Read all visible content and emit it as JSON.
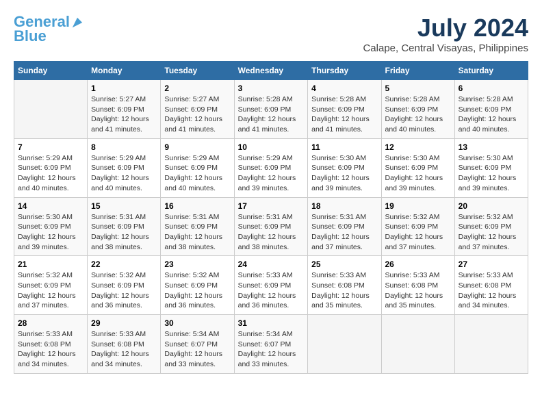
{
  "logo": {
    "line1": "General",
    "line2": "Blue"
  },
  "title": "July 2024",
  "subtitle": "Calape, Central Visayas, Philippines",
  "days_header": [
    "Sunday",
    "Monday",
    "Tuesday",
    "Wednesday",
    "Thursday",
    "Friday",
    "Saturday"
  ],
  "weeks": [
    [
      {
        "num": "",
        "info": ""
      },
      {
        "num": "1",
        "info": "Sunrise: 5:27 AM\nSunset: 6:09 PM\nDaylight: 12 hours\nand 41 minutes."
      },
      {
        "num": "2",
        "info": "Sunrise: 5:27 AM\nSunset: 6:09 PM\nDaylight: 12 hours\nand 41 minutes."
      },
      {
        "num": "3",
        "info": "Sunrise: 5:28 AM\nSunset: 6:09 PM\nDaylight: 12 hours\nand 41 minutes."
      },
      {
        "num": "4",
        "info": "Sunrise: 5:28 AM\nSunset: 6:09 PM\nDaylight: 12 hours\nand 41 minutes."
      },
      {
        "num": "5",
        "info": "Sunrise: 5:28 AM\nSunset: 6:09 PM\nDaylight: 12 hours\nand 40 minutes."
      },
      {
        "num": "6",
        "info": "Sunrise: 5:28 AM\nSunset: 6:09 PM\nDaylight: 12 hours\nand 40 minutes."
      }
    ],
    [
      {
        "num": "7",
        "info": "Sunrise: 5:29 AM\nSunset: 6:09 PM\nDaylight: 12 hours\nand 40 minutes."
      },
      {
        "num": "8",
        "info": "Sunrise: 5:29 AM\nSunset: 6:09 PM\nDaylight: 12 hours\nand 40 minutes."
      },
      {
        "num": "9",
        "info": "Sunrise: 5:29 AM\nSunset: 6:09 PM\nDaylight: 12 hours\nand 40 minutes."
      },
      {
        "num": "10",
        "info": "Sunrise: 5:29 AM\nSunset: 6:09 PM\nDaylight: 12 hours\nand 39 minutes."
      },
      {
        "num": "11",
        "info": "Sunrise: 5:30 AM\nSunset: 6:09 PM\nDaylight: 12 hours\nand 39 minutes."
      },
      {
        "num": "12",
        "info": "Sunrise: 5:30 AM\nSunset: 6:09 PM\nDaylight: 12 hours\nand 39 minutes."
      },
      {
        "num": "13",
        "info": "Sunrise: 5:30 AM\nSunset: 6:09 PM\nDaylight: 12 hours\nand 39 minutes."
      }
    ],
    [
      {
        "num": "14",
        "info": "Sunrise: 5:30 AM\nSunset: 6:09 PM\nDaylight: 12 hours\nand 39 minutes."
      },
      {
        "num": "15",
        "info": "Sunrise: 5:31 AM\nSunset: 6:09 PM\nDaylight: 12 hours\nand 38 minutes."
      },
      {
        "num": "16",
        "info": "Sunrise: 5:31 AM\nSunset: 6:09 PM\nDaylight: 12 hours\nand 38 minutes."
      },
      {
        "num": "17",
        "info": "Sunrise: 5:31 AM\nSunset: 6:09 PM\nDaylight: 12 hours\nand 38 minutes."
      },
      {
        "num": "18",
        "info": "Sunrise: 5:31 AM\nSunset: 6:09 PM\nDaylight: 12 hours\nand 37 minutes."
      },
      {
        "num": "19",
        "info": "Sunrise: 5:32 AM\nSunset: 6:09 PM\nDaylight: 12 hours\nand 37 minutes."
      },
      {
        "num": "20",
        "info": "Sunrise: 5:32 AM\nSunset: 6:09 PM\nDaylight: 12 hours\nand 37 minutes."
      }
    ],
    [
      {
        "num": "21",
        "info": "Sunrise: 5:32 AM\nSunset: 6:09 PM\nDaylight: 12 hours\nand 37 minutes."
      },
      {
        "num": "22",
        "info": "Sunrise: 5:32 AM\nSunset: 6:09 PM\nDaylight: 12 hours\nand 36 minutes."
      },
      {
        "num": "23",
        "info": "Sunrise: 5:32 AM\nSunset: 6:09 PM\nDaylight: 12 hours\nand 36 minutes."
      },
      {
        "num": "24",
        "info": "Sunrise: 5:33 AM\nSunset: 6:09 PM\nDaylight: 12 hours\nand 36 minutes."
      },
      {
        "num": "25",
        "info": "Sunrise: 5:33 AM\nSunset: 6:08 PM\nDaylight: 12 hours\nand 35 minutes."
      },
      {
        "num": "26",
        "info": "Sunrise: 5:33 AM\nSunset: 6:08 PM\nDaylight: 12 hours\nand 35 minutes."
      },
      {
        "num": "27",
        "info": "Sunrise: 5:33 AM\nSunset: 6:08 PM\nDaylight: 12 hours\nand 34 minutes."
      }
    ],
    [
      {
        "num": "28",
        "info": "Sunrise: 5:33 AM\nSunset: 6:08 PM\nDaylight: 12 hours\nand 34 minutes."
      },
      {
        "num": "29",
        "info": "Sunrise: 5:33 AM\nSunset: 6:08 PM\nDaylight: 12 hours\nand 34 minutes."
      },
      {
        "num": "30",
        "info": "Sunrise: 5:34 AM\nSunset: 6:07 PM\nDaylight: 12 hours\nand 33 minutes."
      },
      {
        "num": "31",
        "info": "Sunrise: 5:34 AM\nSunset: 6:07 PM\nDaylight: 12 hours\nand 33 minutes."
      },
      {
        "num": "",
        "info": ""
      },
      {
        "num": "",
        "info": ""
      },
      {
        "num": "",
        "info": ""
      }
    ]
  ]
}
